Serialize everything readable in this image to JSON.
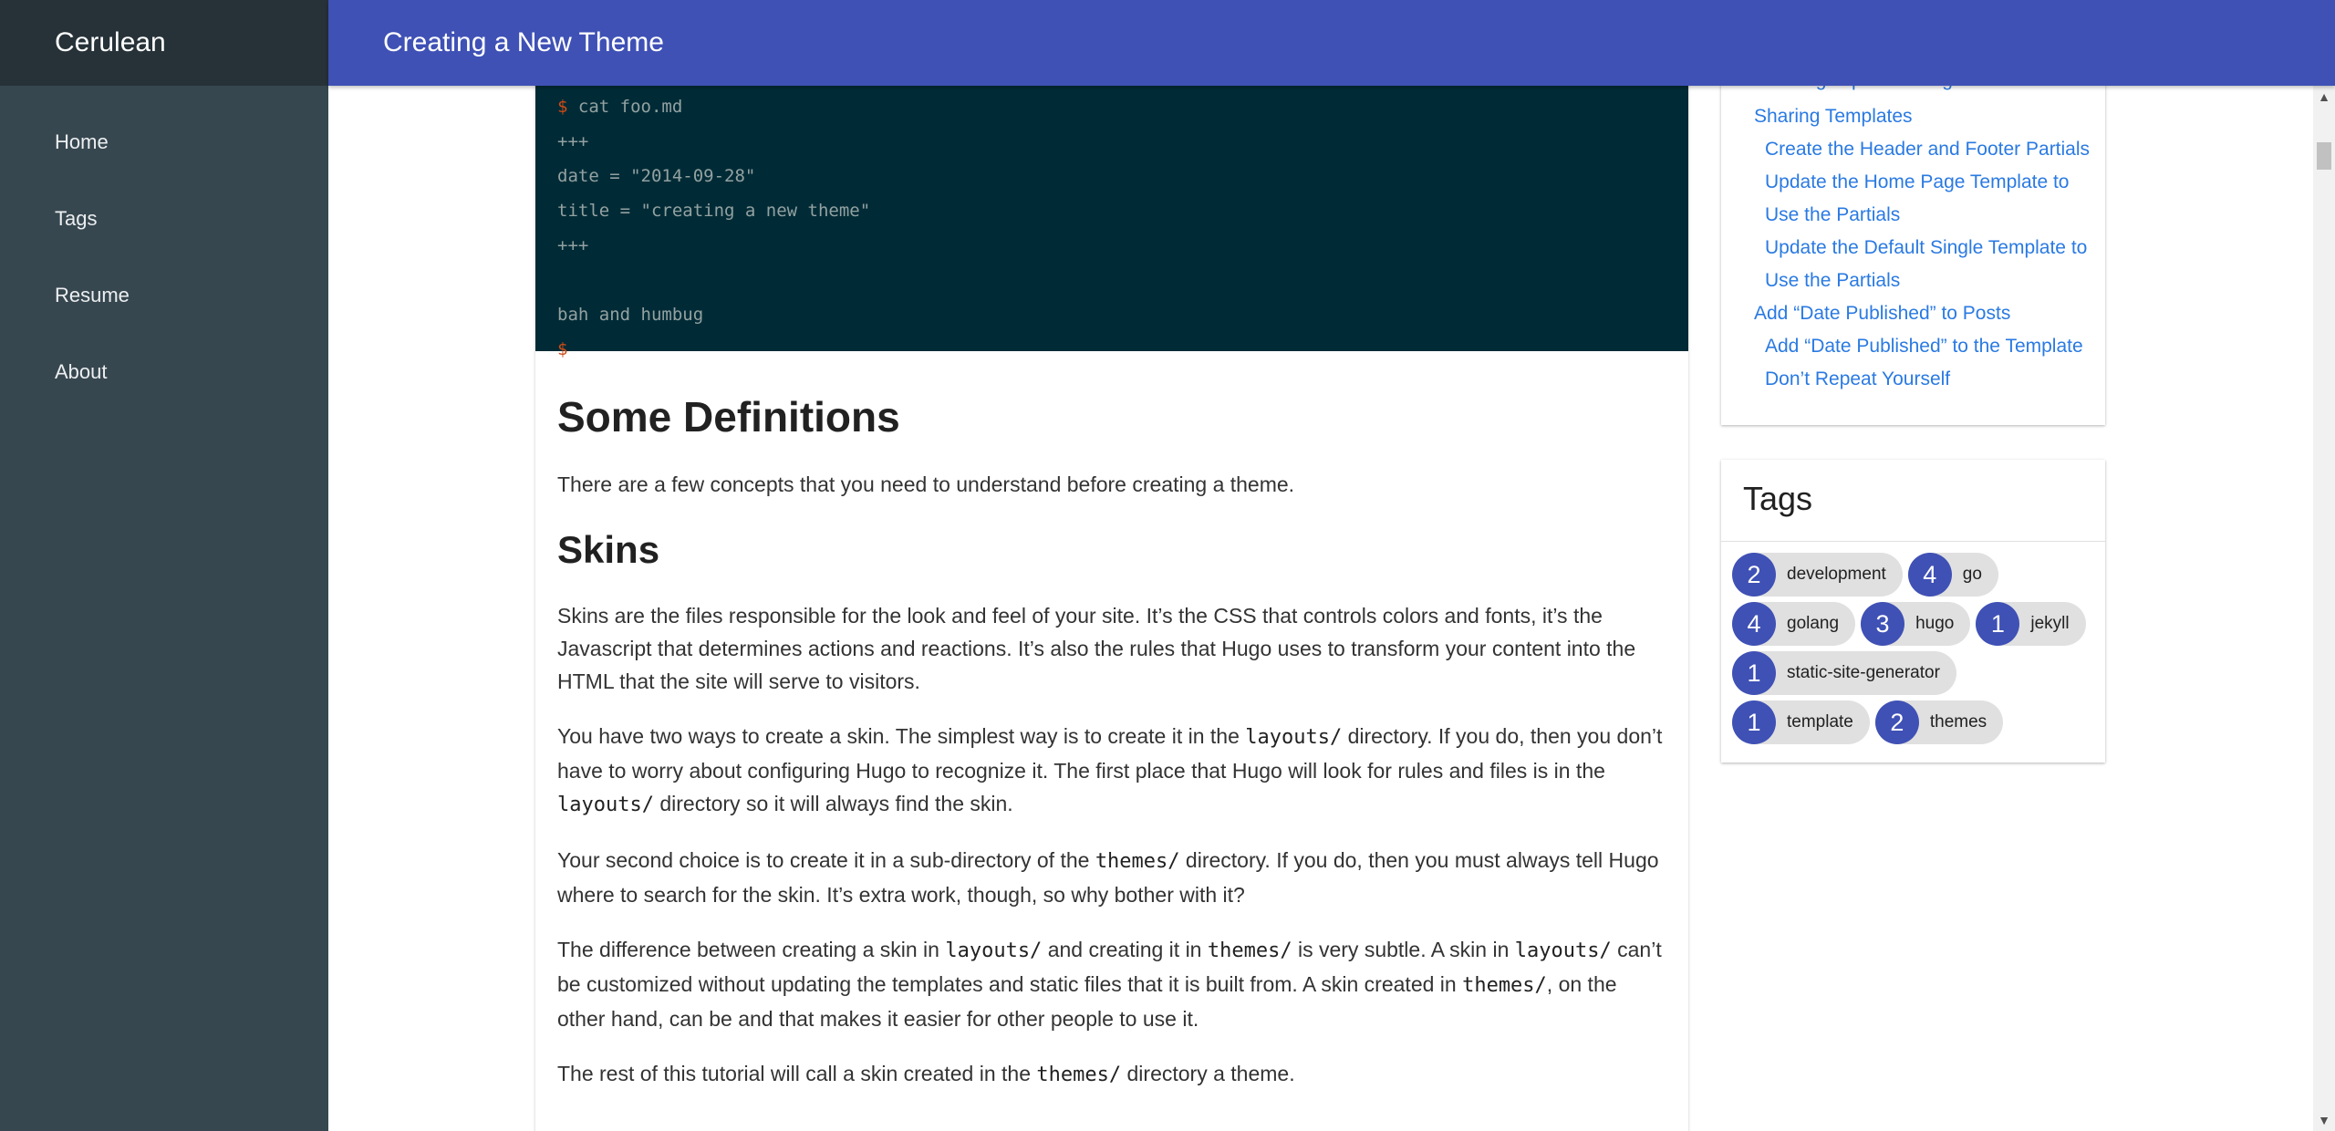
{
  "sidebar": {
    "site_title": "Cerulean",
    "nav": [
      {
        "label": "Home"
      },
      {
        "label": "Tags"
      },
      {
        "label": "Resume"
      },
      {
        "label": "About"
      }
    ]
  },
  "header": {
    "title": "Creating a New Theme"
  },
  "article": {
    "code_lines": [
      {
        "prompt": "$",
        "text": " cat foo.md"
      },
      {
        "prompt": "",
        "text": "+++"
      },
      {
        "prompt": "",
        "text": "date = \"2014-09-28\""
      },
      {
        "prompt": "",
        "text": "title = \"creating a new theme\""
      },
      {
        "prompt": "",
        "text": "+++"
      },
      {
        "prompt": "",
        "text": ""
      },
      {
        "prompt": "",
        "text": "bah and humbug"
      },
      {
        "prompt": "$",
        "text": ""
      }
    ],
    "h_definitions": "Some Definitions",
    "p_definitions": "There are a few concepts that you need to understand before creating a theme.",
    "h_skins": "Skins",
    "p1": "Skins are the files responsible for the look and feel of your site. It’s the CSS that controls colors and fonts, it’s the Javascript that determines actions and reactions. It’s also the rules that Hugo uses to transform your content into the HTML that the site will serve to visitors.",
    "p2_a": "You have two ways to create a skin. The simplest way is to create it in the ",
    "p2_code1": "layouts/",
    "p2_b": " directory. If you do, then you don’t have to worry about configuring Hugo to recognize it. The first place that Hugo will look for rules and files is in the ",
    "p2_code2": "layouts/",
    "p2_c": " directory so it will always find the skin.",
    "p3_a": "Your second choice is to create it in a sub-directory of the ",
    "p3_code": "themes/",
    "p3_b": " directory. If you do, then you must always tell Hugo where to search for the skin. It’s extra work, though, so why bother with it?",
    "p4_a": "The difference between creating a skin in ",
    "p4_code1": "layouts/",
    "p4_b": " and creating it in ",
    "p4_code2": "themes/",
    "p4_c": " is very subtle. A skin in ",
    "p4_code3": "layouts/",
    "p4_d": " can’t be customized without updating the templates and static files that it is built from. A skin created in ",
    "p4_code4": "themes/",
    "p4_e": ", on the other hand, can be and that makes it easier for other people to use it.",
    "p5_a": "The rest of this tutorial will call a skin created in the ",
    "p5_code": "themes/",
    "p5_b": " directory a theme."
  },
  "toc": {
    "clipped_item": "Creating Top Level Pages",
    "items": [
      {
        "label": "Sharing Templates",
        "level": 1
      },
      {
        "label": "Create the Header and Footer Partials",
        "level": 2
      },
      {
        "label": "Update the Home Page Template to",
        "level": 2
      },
      {
        "label": "Use the Partials",
        "level": 2
      },
      {
        "label": "Update the Default Single Template to",
        "level": 2
      },
      {
        "label": "Use the Partials",
        "level": 2
      },
      {
        "label": "Add “Date Published” to Posts",
        "level": 1
      },
      {
        "label": "Add “Date Published” to the Template",
        "level": 2
      },
      {
        "label": "Don’t Repeat Yourself",
        "level": 2
      }
    ]
  },
  "tags": {
    "title": "Tags",
    "chips": [
      {
        "count": "2",
        "label": "development"
      },
      {
        "count": "4",
        "label": "go"
      },
      {
        "count": "4",
        "label": "golang"
      },
      {
        "count": "3",
        "label": "hugo"
      },
      {
        "count": "1",
        "label": "jekyll"
      },
      {
        "count": "1",
        "label": "static-site-generator"
      },
      {
        "count": "1",
        "label": "template"
      },
      {
        "count": "2",
        "label": "themes"
      }
    ]
  },
  "scrollbar": {
    "up_icon": "▲",
    "down_icon": "▼"
  },
  "colors": {
    "sidebar_bg": "#37474f",
    "sidebar_head_bg": "#263238",
    "header_bg": "#3f51b5",
    "code_bg": "#002b36",
    "link": "#2a7ae2",
    "chip_count_bg": "#3f51b5"
  }
}
